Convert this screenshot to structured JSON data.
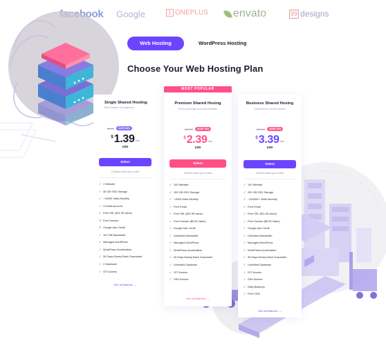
{
  "brands": [
    "facebook",
    "Google",
    "ONEPLUS",
    "envato",
    "designs"
  ],
  "brand_marks": {
    "oneplus_box": "1",
    "designs_box": "99"
  },
  "tabs": [
    {
      "label": "Web Hosting",
      "active": true
    },
    {
      "label": "WordPress Hosting",
      "active": false
    }
  ],
  "title": "Choose Your Web Hosting Plan",
  "colors": {
    "accent": "#6c44ff",
    "popular": "#ff4f86",
    "text": "#1c1c2e"
  },
  "plans": [
    {
      "name": "Single Shared Hosting",
      "subtitle": "Best Solution for beginners",
      "old_price": "$5.49",
      "save": "SAVE 68%",
      "currency": "$",
      "price": "1.39",
      "per": "/mo",
      "unit": "USD",
      "button": "Select",
      "renew": "2.99/mo when you renew",
      "features": [
        {
          "mark": "check",
          "text": "1 Website"
        },
        {
          "mark": "check",
          "text": "30 GB SSD Storage"
        },
        {
          "mark": "check",
          "text": "~10000 Visits Monthly"
        },
        {
          "mark": "check",
          "text": "1 Email Account"
        },
        {
          "mark": "check",
          "text": "Free SSL ($11.95 value)"
        },
        {
          "mark": "cross",
          "text": "Free Domain"
        },
        {
          "mark": "cross",
          "text": "Google Ads Credit"
        },
        {
          "mark": "check",
          "text": "100 GB Bandwidth"
        },
        {
          "mark": "check",
          "text": "Managed wordPress"
        },
        {
          "mark": "check",
          "text": "WordPress Acceleration"
        },
        {
          "mark": "check",
          "text": "30 Days Money Back Guarantee"
        },
        {
          "mark": "check",
          "text": "2 Database"
        },
        {
          "mark": "check",
          "text": "GIT Access"
        }
      ],
      "see_all": "See all features",
      "icons": {
        "check": "✓",
        "cross": "✕",
        "chevron": "⌄"
      }
    },
    {
      "badge": "MOST POPULAR",
      "name": "Premium Shared Hosing",
      "subtitle": "Perfect package personal Websites",
      "old_price": "$10.29",
      "save": "SAVE 75%",
      "currency": "$",
      "price": "2.39",
      "per": "/mo",
      "unit": "USD",
      "button": "Select",
      "renew": "5.99/mo when you renew",
      "features": [
        {
          "mark": "check",
          "text": "100 Website"
        },
        {
          "mark": "check",
          "text": "100 GB SSD Storage"
        },
        {
          "mark": "check",
          "text": "~2500 Visits Monthly"
        },
        {
          "mark": "check",
          "text": "Free Email"
        },
        {
          "mark": "check",
          "text": "Free SSL ($11.95 value)"
        },
        {
          "mark": "check",
          "text": "Free Domain ($9.99 Value)"
        },
        {
          "mark": "check",
          "text": "Google Ads Credit"
        },
        {
          "mark": "check",
          "text": "Unlimited Bandwidth"
        },
        {
          "mark": "check",
          "text": "Managed WordPress"
        },
        {
          "mark": "check",
          "text": "WordPress Acceleration"
        },
        {
          "mark": "check",
          "text": "30 Days Money Back Guarantee"
        },
        {
          "mark": "check",
          "text": "Unlimited Database"
        },
        {
          "mark": "check",
          "text": "GIT Access"
        },
        {
          "mark": "check",
          "text": "SSH Access"
        }
      ],
      "see_all": "See all features"
    },
    {
      "name": "Business Shared Hosing",
      "subtitle": "Optimized for small business",
      "old_price": "$15.99",
      "save": "SAVE 75%",
      "currency": "$",
      "price": "3.39",
      "per": "/mo",
      "unit": "USD",
      "button": "Select",
      "renew": "8.99/mo when you renew",
      "features": [
        {
          "mark": "check",
          "text": "100 Website"
        },
        {
          "mark": "check",
          "text": "200 GB SSD Storage"
        },
        {
          "mark": "check",
          "text": "~100000+ Visits Monthly"
        },
        {
          "mark": "check",
          "text": "Free Email"
        },
        {
          "mark": "check",
          "text": "Free SSL ($11.95 value)"
        },
        {
          "mark": "check",
          "text": "Free Domain ($9.99 Value)"
        },
        {
          "mark": "check",
          "text": "Google Ads Credit"
        },
        {
          "mark": "check",
          "text": "Unlimited Bandwidth"
        },
        {
          "mark": "check",
          "text": "Managed WordPress"
        },
        {
          "mark": "check",
          "text": "WordPress Acceleration"
        },
        {
          "mark": "check",
          "text": "30 Days Money Back Guarantee"
        },
        {
          "mark": "check",
          "text": "Unlimited Database"
        },
        {
          "mark": "check",
          "text": "GIT Access"
        },
        {
          "mark": "check",
          "text": "SSH Access"
        },
        {
          "mark": "check",
          "text": "Daily Backups"
        },
        {
          "mark": "check",
          "text": "Free CDN"
        }
      ],
      "see_all": "See all features"
    }
  ]
}
